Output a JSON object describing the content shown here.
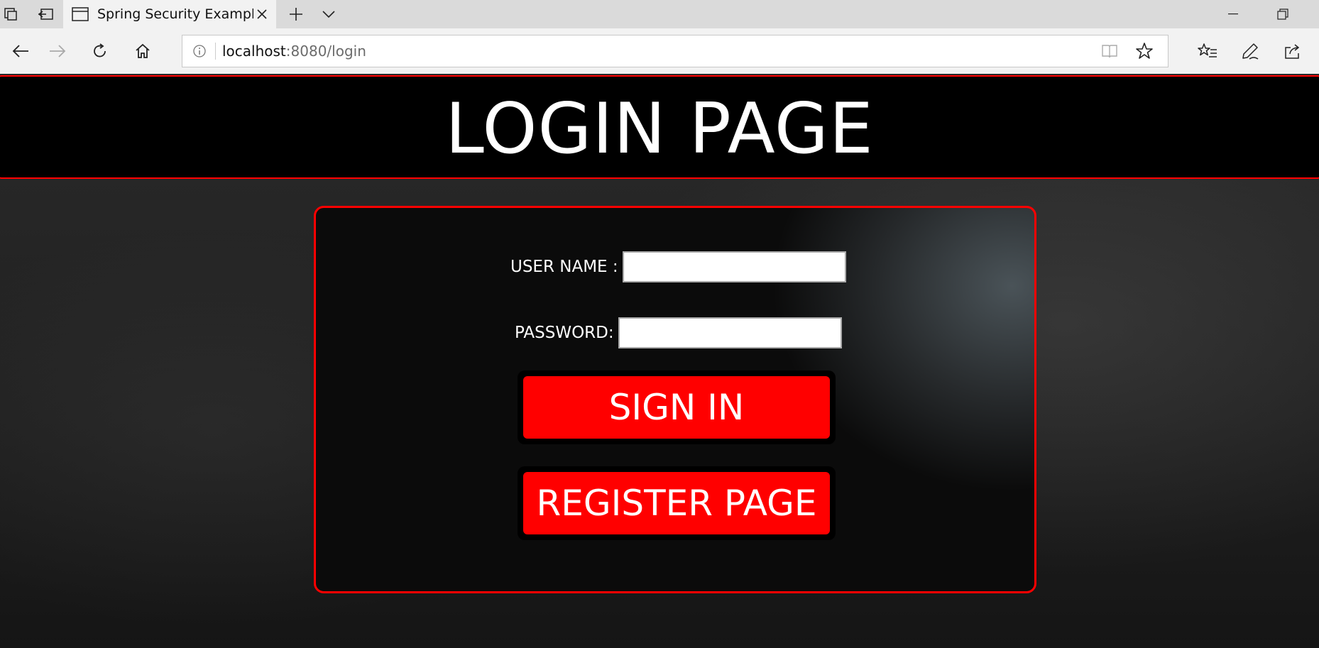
{
  "browser": {
    "tab_title": "Spring Security Example",
    "url_host": "localhost",
    "url_rest": ":8080/login"
  },
  "page": {
    "heading": "LOGIN PAGE",
    "username_label": "USER NAME :",
    "username_value": "",
    "password_label": "PASSWORD:",
    "password_value": "",
    "signin_label": "SIGN IN",
    "register_label": "REGISTER PAGE"
  },
  "colors": {
    "accent": "#ff0000",
    "header_bg": "#000000",
    "chrome_bg": "#f2f2f2"
  }
}
